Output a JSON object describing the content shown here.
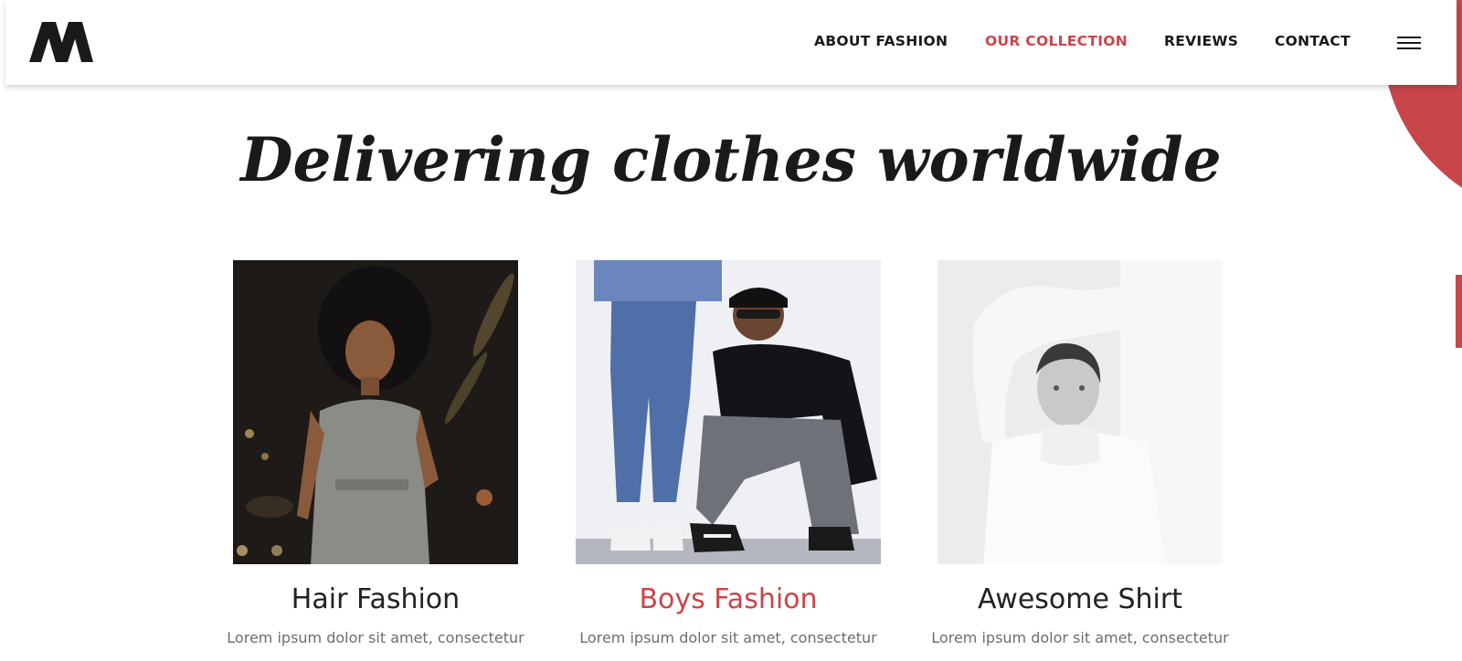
{
  "header": {
    "logo_alt": "M",
    "nav": [
      {
        "label": "ABOUT FASHION",
        "active": false
      },
      {
        "label": "OUR COLLECTION",
        "active": true
      },
      {
        "label": "REVIEWS",
        "active": false
      },
      {
        "label": "CONTACT",
        "active": false
      }
    ],
    "menu_icon": "hamburger-menu-icon"
  },
  "hero": {
    "title": "Delivering clothes worldwide"
  },
  "collection": [
    {
      "name": "Hair Fashion",
      "description": "Lorem ipsum dolor sit amet, consectetur",
      "highlighted": false
    },
    {
      "name": "Boys Fashion",
      "description": "Lorem ipsum dolor sit amet, consectetur",
      "highlighted": true
    },
    {
      "name": "Awesome Shirt",
      "description": "Lorem ipsum dolor sit amet, consectetur",
      "highlighted": false
    }
  ],
  "colors": {
    "accent": "#c8464a",
    "text_dark": "#1a1a1a",
    "text_muted": "#6d6d6d",
    "background": "#ffffff"
  }
}
